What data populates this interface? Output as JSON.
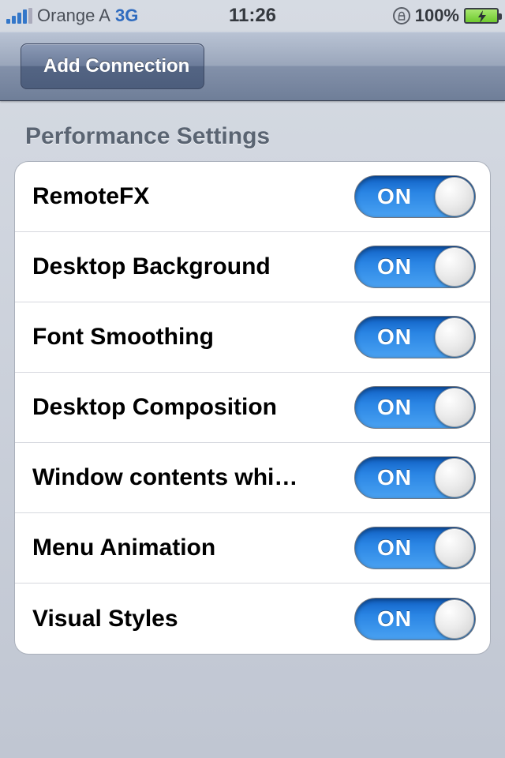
{
  "status_bar": {
    "carrier": "Orange A",
    "network": "3G",
    "time": "11:26",
    "battery_pct": "100%"
  },
  "nav": {
    "back_label": "Add Connection"
  },
  "section": {
    "title": "Performance Settings",
    "rows": [
      {
        "label": "RemoteFX",
        "on_text": "ON"
      },
      {
        "label": "Desktop Background",
        "on_text": "ON"
      },
      {
        "label": "Font Smoothing",
        "on_text": "ON"
      },
      {
        "label": "Desktop Composition",
        "on_text": "ON"
      },
      {
        "label": "Window contents whi…",
        "on_text": "ON"
      },
      {
        "label": "Menu Animation",
        "on_text": "ON"
      },
      {
        "label": "Visual Styles",
        "on_text": "ON"
      }
    ]
  }
}
